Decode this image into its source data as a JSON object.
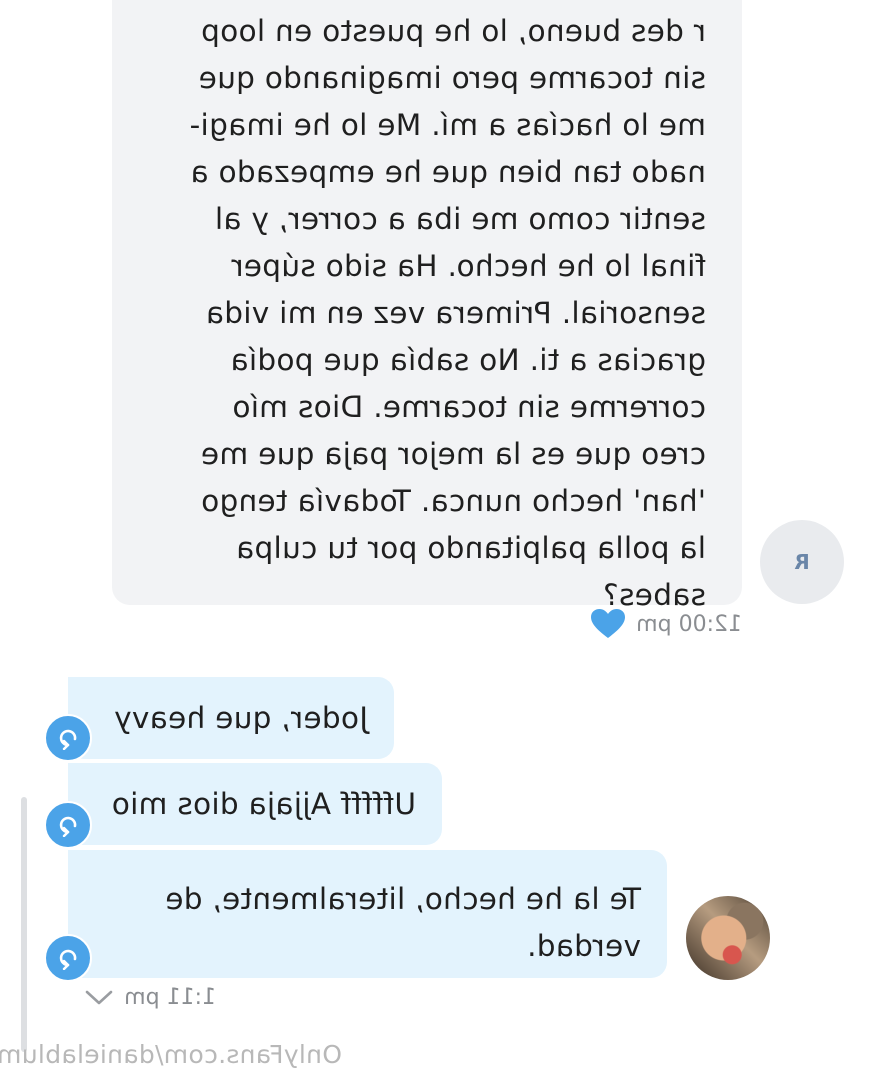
{
  "incoming_message": {
    "lines": [
      "r des bueno, lo he puesto en loop",
      "sin tocarme pero imaginando que",
      "me lo hacías a mí. Me lo he imagi-",
      "nado tan bien que he empezado a",
      "sentir como me iba a correr, y al",
      "final lo he hecho. Ha sido súper",
      "sensorial. Primera vez en mi vida",
      "gracias a ti. No sabía que podía",
      "correrme sin tocarme. Dios mío",
      "creo que es la mejor paja que me",
      "'han' hecho nunca. Todavía tengo",
      "la polla palpitando por tu culpa",
      "sabes?"
    ],
    "time": "12:00 pm",
    "liked": true,
    "avatar_initial": "R",
    "like_icon": "heart-icon",
    "like_color": "#4ba3e8"
  },
  "outgoing_messages": [
    {
      "text": "Joder, que heavy"
    },
    {
      "text": "Ufffff Ajjaja dios mio"
    },
    {
      "text": "Te la he hecho, literalmente, de\nverdad."
    }
  ],
  "outgoing_time": "1:11 pm",
  "watermark": "OnlyFans.com/danielablume",
  "colors": {
    "incoming_bubble": "#f2f3f5",
    "outgoing_bubble": "#e3f3fd",
    "accent": "#4ba3e8"
  }
}
